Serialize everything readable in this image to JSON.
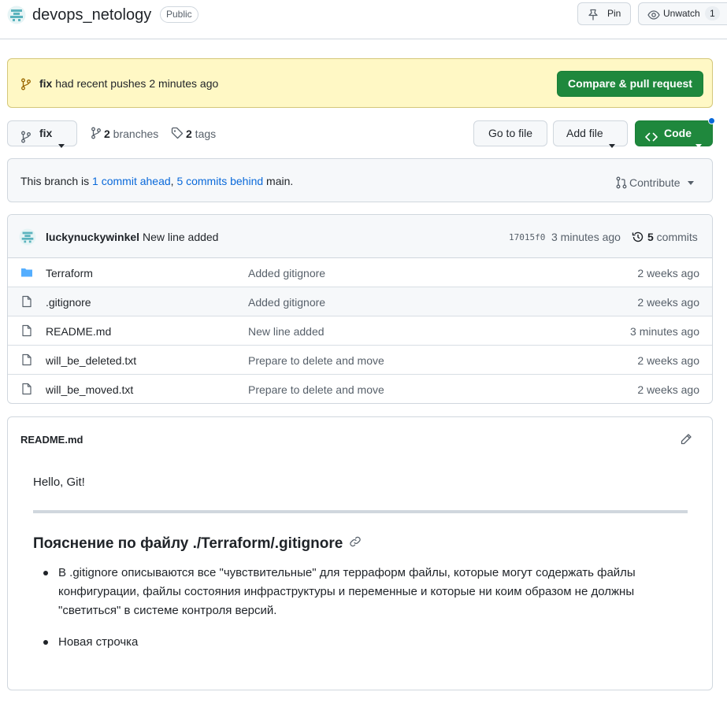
{
  "repo": {
    "name": "devops_netology",
    "visibility": "Public",
    "pin_label": "Pin",
    "watch_label": "Unwatch",
    "watch_count": "1"
  },
  "push_banner": {
    "branch": "fix",
    "message": " had recent pushes 2 minutes ago",
    "compare_label": "Compare & pull request"
  },
  "toolbar": {
    "branch": "fix",
    "branches_count": "2",
    "branches_label": " branches",
    "tags_count": "2",
    "tags_label": " tags",
    "go_to_file": "Go to file",
    "add_file": "Add file",
    "code": "Code"
  },
  "branch_status": {
    "prefix": "This branch is ",
    "ahead": "1 commit ahead",
    "sep": ", ",
    "behind": "5 commits behind",
    "suffix": " main.",
    "contribute": "Contribute"
  },
  "latest_commit": {
    "author": "luckynuckywinkel",
    "message": " New line added",
    "sha": "17015f0",
    "ago": "3 minutes ago",
    "commits_count": "5",
    "commits_label": " commits"
  },
  "files": [
    {
      "name": "Terraform",
      "type": "folder",
      "message": "Added gitignore",
      "age": "2 weeks ago"
    },
    {
      "name": ".gitignore",
      "type": "file",
      "message": "Added gitignore",
      "age": "2 weeks ago"
    },
    {
      "name": "README.md",
      "type": "file",
      "message": "New line added",
      "age": "3 minutes ago"
    },
    {
      "name": "will_be_deleted.txt",
      "type": "file",
      "message": "Prepare to delete and move",
      "age": "2 weeks ago"
    },
    {
      "name": "will_be_moved.txt",
      "type": "file",
      "message": "Prepare to delete and move",
      "age": "2 weeks ago"
    }
  ],
  "readme": {
    "title": "README.md",
    "hello": "Hello, Git!",
    "heading": "Пояснение по файлу ./Terraform/.gitignore",
    "items": [
      "В .gitignore описываются все \"чувствительные\" для терраформ файлы, которые могут содержать файлы конфигурации, файлы состояния инфраструктуры и переменные и которые ни коим образом не должны \"светиться\" в системе контроля версий.",
      "Новая строчка"
    ]
  },
  "colors": {
    "accent_green": "#1f883d",
    "link_blue": "#0969da",
    "banner_yellow": "#fff8c5",
    "folder_blue": "#54aeff"
  }
}
